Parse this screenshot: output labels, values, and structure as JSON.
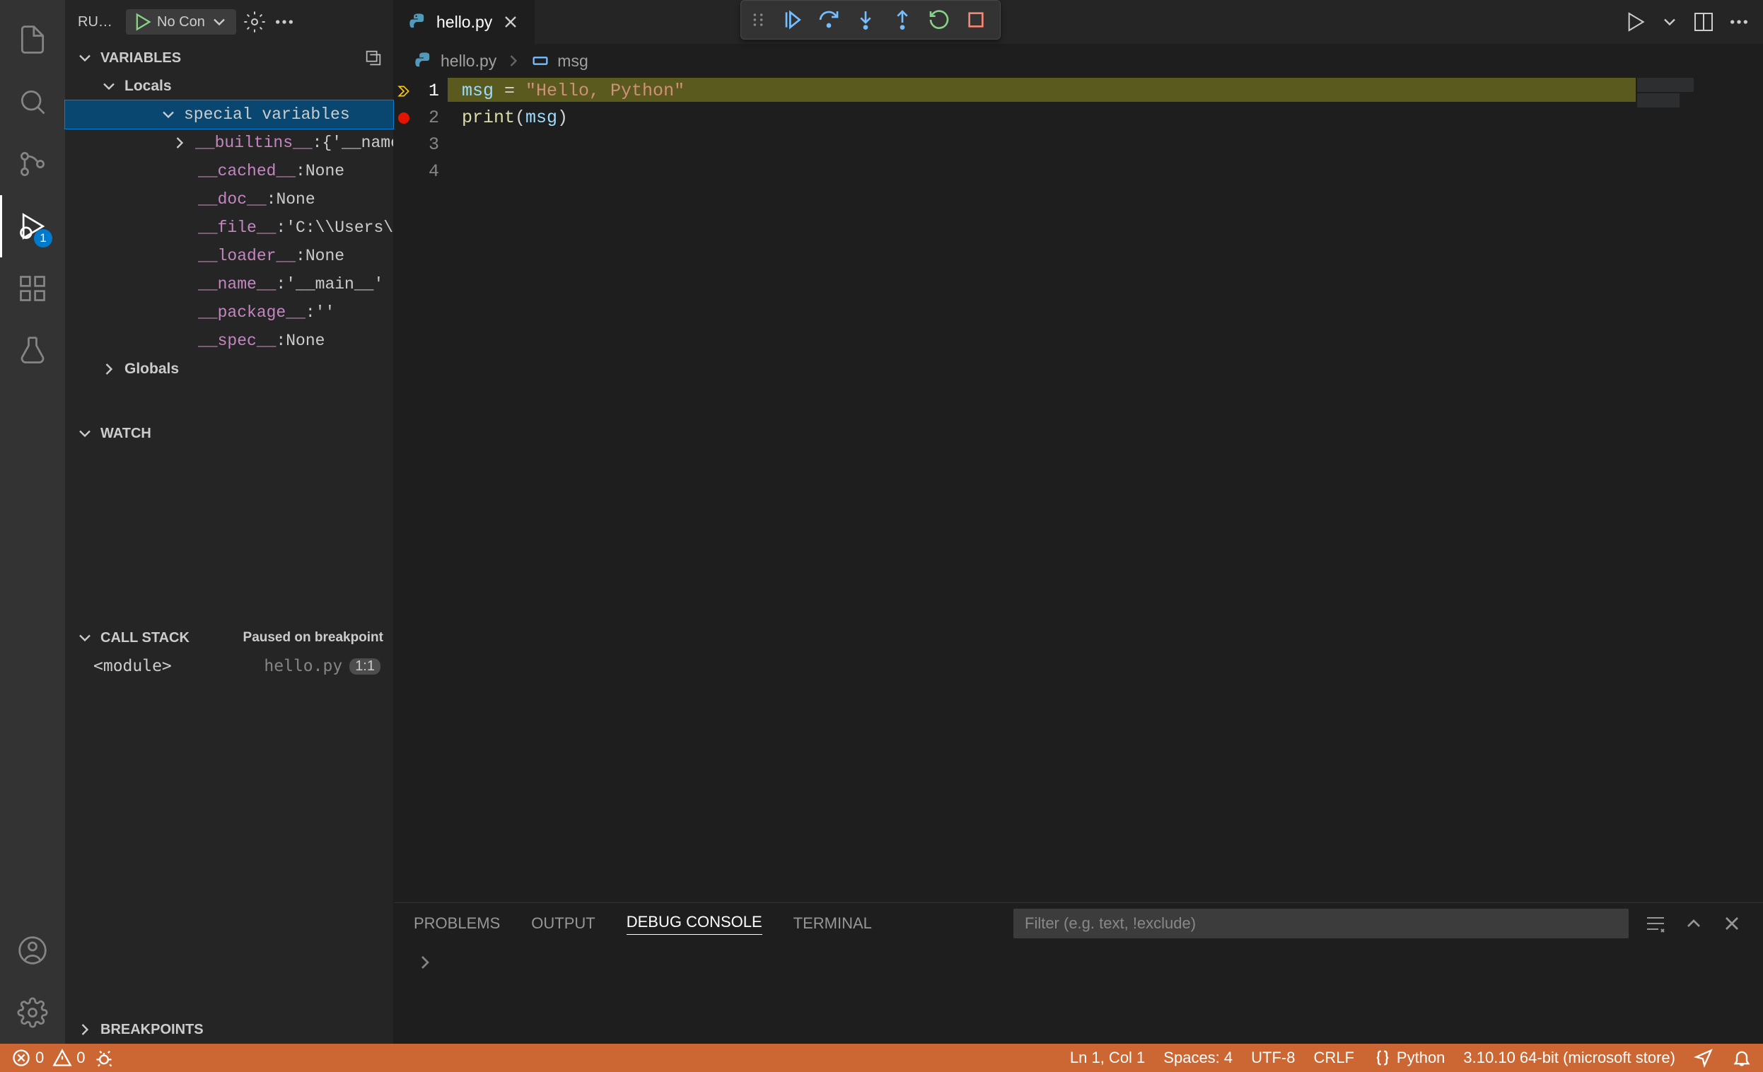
{
  "activity": {
    "debug_badge": "1"
  },
  "sidebar": {
    "title": "RU…",
    "config": "No Con",
    "variables": {
      "title": "Variables",
      "locals": "Locals",
      "special": "special variables",
      "items": [
        {
          "key": "__builtins__",
          "val": "{'__name…"
        },
        {
          "key": "__cached__",
          "val": "None"
        },
        {
          "key": "__doc__",
          "val": "None"
        },
        {
          "key": "__file__",
          "val": "'C:\\\\Users\\\\…"
        },
        {
          "key": "__loader__",
          "val": "None"
        },
        {
          "key": "__name__",
          "val": "'__main__'"
        },
        {
          "key": "__package__",
          "val": "''"
        },
        {
          "key": "__spec__",
          "val": "None"
        }
      ],
      "globals": "Globals"
    },
    "watch": {
      "title": "Watch"
    },
    "callstack": {
      "title": "Call Stack",
      "status": "Paused on breakpoint",
      "frame_fn": "<module>",
      "frame_file": "hello.py",
      "frame_pos": "1:1"
    },
    "breakpoints": {
      "title": "Breakpoints"
    }
  },
  "tabs": {
    "file": "hello.py"
  },
  "breadcrumb": {
    "file": "hello.py",
    "symbol": "msg"
  },
  "code": {
    "line_numbers": [
      "1",
      "2",
      "3",
      "4"
    ],
    "l1_var": "msg",
    "l1_op": " = ",
    "l1_str": "\"Hello, Python\"",
    "l2_fn": "print",
    "l2_open": "(",
    "l2_arg": "msg",
    "l2_close": ")"
  },
  "panel": {
    "tabs": {
      "problems": "PROBLEMS",
      "output": "OUTPUT",
      "debug": "DEBUG CONSOLE",
      "terminal": "TERMINAL"
    },
    "filter_placeholder": "Filter (e.g. text, !exclude)"
  },
  "status": {
    "errors": "0",
    "warnings": "0",
    "ln_col": "Ln 1, Col 1",
    "spaces": "Spaces: 4",
    "encoding": "UTF-8",
    "eol": "CRLF",
    "lang": "Python",
    "interpreter": "3.10.10 64-bit (microsoft store)"
  }
}
